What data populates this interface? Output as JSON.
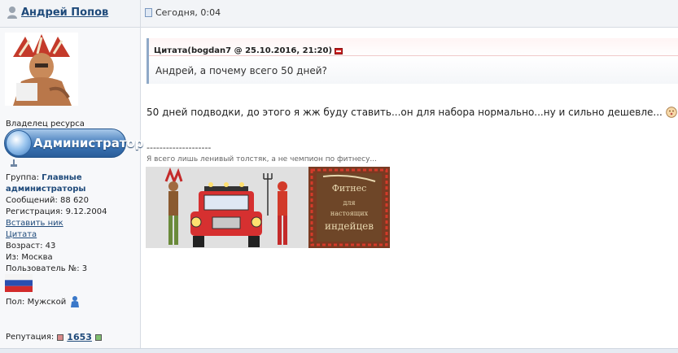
{
  "post": {
    "author": "Андрей Попов",
    "date": "Сегодня, 0:04"
  },
  "profile": {
    "owner_label": "Владелец ресурса",
    "badge_text": "Администратор",
    "group_label": "Группа:",
    "group_value_line1": "Главные",
    "group_value_line2": "администраторы",
    "posts": "Сообщений: 88 620",
    "registration": "Регистрация: 9.12.2004",
    "insert_nick": "Вставить ник",
    "quote_link": "Цитата",
    "age": "Возраст: 43",
    "from": "Из: Москва",
    "user_no": "Пользователь №: 3",
    "gender": "Пол: Мужской",
    "reputation_label": "Репутация:",
    "reputation_value": "1653"
  },
  "quote": {
    "header": "Цитата(bogdan7 @ 25.10.2016, 21:20)",
    "text": "Андрей, а почему всего 50 дней?"
  },
  "message": {
    "text": "50 дней подводки, до этого я жж буду ставить...он для набора нормально...ну и сильно дешевле..."
  },
  "signature": {
    "separator": "--------------------",
    "text": "Я всего лишь ленивый толстяк, а не чемпион по фитнесу...",
    "banner_text": "Фитнес для настоящих индейцев"
  },
  "icons": {
    "author": "user-icon",
    "date": "document-icon",
    "quote_back": "back-arrow-icon",
    "gender": "male-icon",
    "smile": "smile-icon"
  },
  "colors": {
    "link": "#1f4a7a",
    "badge": "#3d76b7",
    "quote_border": "#8fa9c8"
  }
}
